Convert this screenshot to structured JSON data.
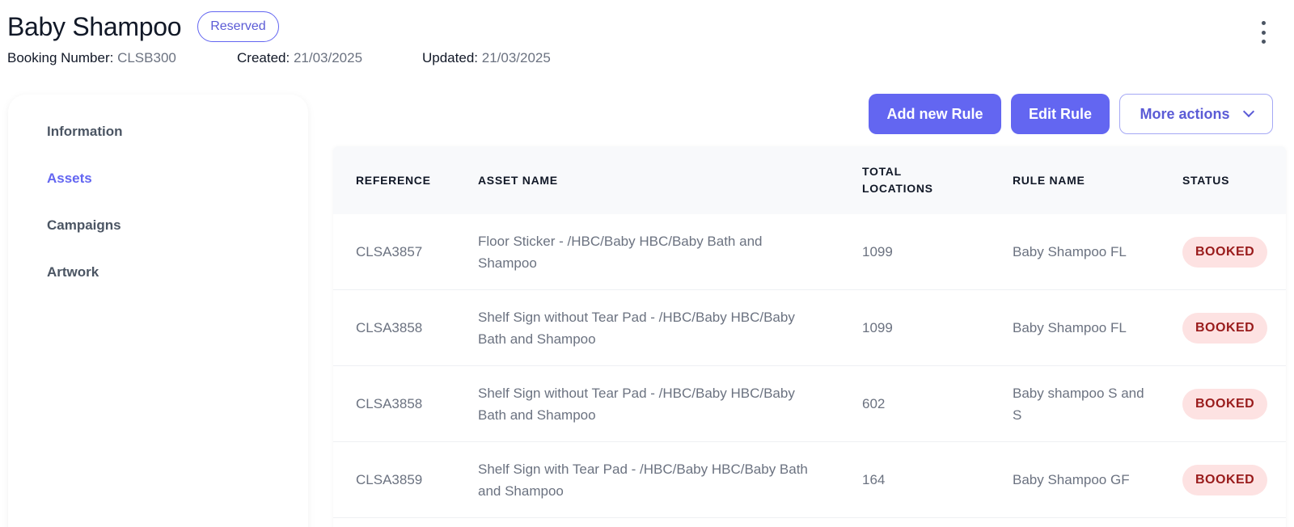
{
  "header": {
    "title": "Baby Shampoo",
    "status": "Reserved",
    "booking_label": "Booking Number:",
    "booking_value": "CLSB300",
    "created_label": "Created:",
    "created_value": "21/03/2025",
    "updated_label": "Updated:",
    "updated_value": "21/03/2025"
  },
  "sidebar": {
    "items": [
      {
        "label": "Information"
      },
      {
        "label": "Assets",
        "active": true
      },
      {
        "label": "Campaigns"
      },
      {
        "label": "Artwork"
      }
    ]
  },
  "actions": {
    "add_rule": "Add new Rule",
    "edit_rule": "Edit Rule",
    "more_actions": "More actions"
  },
  "table": {
    "headers": {
      "reference": "REFERENCE",
      "asset_name": "ASSET NAME",
      "total_locations_1": "TOTAL",
      "total_locations_2": "LOCATIONS",
      "rule_name": "RULE NAME",
      "status": "STATUS"
    },
    "rows": [
      {
        "reference": "CLSA3857",
        "asset_name": "Floor Sticker - /HBC/Baby HBC/Baby Bath and Shampoo",
        "total_locations": "1099",
        "rule_name": "Baby Shampoo FL",
        "status": "BOOKED"
      },
      {
        "reference": "CLSA3858",
        "asset_name": "Shelf Sign without Tear Pad - /HBC/Baby HBC/Baby Bath and Shampoo",
        "total_locations": "1099",
        "rule_name": "Baby Shampoo FL",
        "status": "BOOKED"
      },
      {
        "reference": "CLSA3858",
        "asset_name": "Shelf Sign without Tear Pad - /HBC/Baby HBC/Baby Bath and Shampoo",
        "total_locations": "602",
        "rule_name": "Baby shampoo S and S",
        "status": "BOOKED"
      },
      {
        "reference": "CLSA3859",
        "asset_name": "Shelf Sign with Tear Pad - /HBC/Baby HBC/Baby Bath and Shampoo",
        "total_locations": "164",
        "rule_name": "Baby Shampoo GF",
        "status": "BOOKED"
      }
    ]
  },
  "colors": {
    "accent": "#6366f1",
    "badge_bg": "#fde2e2",
    "badge_text": "#991b1b"
  },
  "icons": {
    "menu": "kebab-menu-icon",
    "dropdown": "chevron-down-icon"
  }
}
